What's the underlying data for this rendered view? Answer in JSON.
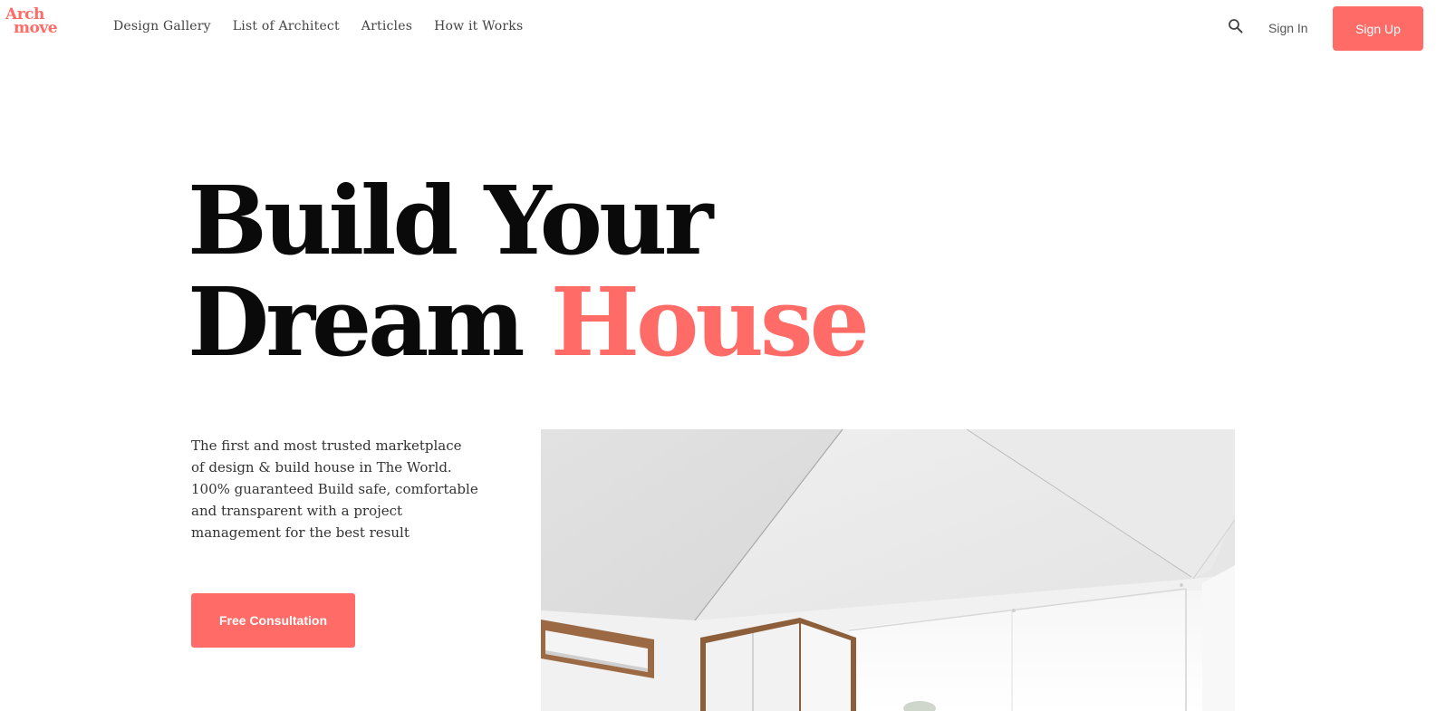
{
  "brand": {
    "logo_line1": "Arch",
    "logo_line2": "move",
    "accent_color": "#ff6b66"
  },
  "nav": {
    "items": [
      {
        "label": "Design Gallery"
      },
      {
        "label": "List of Architect"
      },
      {
        "label": "Articles"
      },
      {
        "label": "How it Works"
      }
    ]
  },
  "header_actions": {
    "search_icon": "search-icon",
    "sign_in_label": "Sign In",
    "sign_up_label": "Sign Up"
  },
  "hero": {
    "title_line1": "Build Your",
    "title_line2_plain": "Dream",
    "title_line2_accent": "House",
    "description_lines": [
      "The first and most trusted marketplace",
      "of design & build house in The World.",
      "100% guaranteed Build safe, comfortable",
      "and transparent with a project",
      "management for the best result"
    ],
    "cta_label": "Free Consultation"
  }
}
